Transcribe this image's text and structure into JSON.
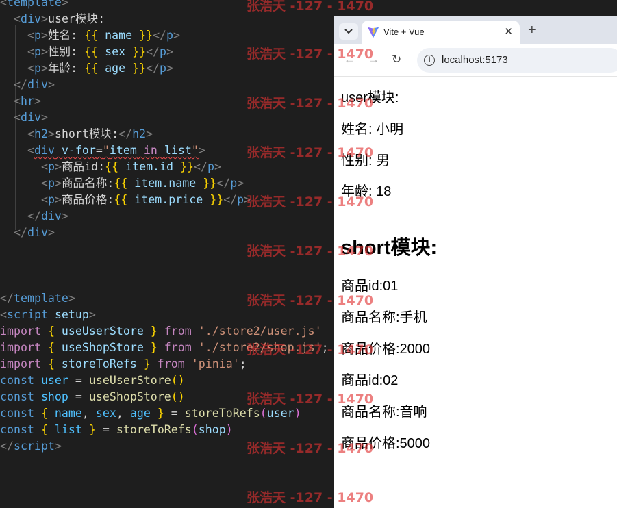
{
  "editor": {
    "lines": [
      [
        [
          "t-br",
          "<"
        ],
        [
          "t-tag",
          "template"
        ],
        [
          "t-br",
          ">"
        ]
      ],
      [
        [
          "t-txt",
          "  "
        ],
        [
          "t-br",
          "<"
        ],
        [
          "t-tag",
          "div"
        ],
        [
          "t-br",
          ">"
        ],
        [
          "t-txt",
          "user模块:"
        ]
      ],
      [
        [
          "t-txt",
          "    "
        ],
        [
          "t-br",
          "<"
        ],
        [
          "t-tag",
          "p"
        ],
        [
          "t-br",
          ">"
        ],
        [
          "t-txt",
          "姓名: "
        ],
        [
          "t-mus",
          "{{"
        ],
        [
          "t-var",
          " name "
        ],
        [
          "t-mus",
          "}}"
        ],
        [
          "t-br",
          "</"
        ],
        [
          "t-tag",
          "p"
        ],
        [
          "t-br",
          ">"
        ]
      ],
      [
        [
          "t-txt",
          "    "
        ],
        [
          "t-br",
          "<"
        ],
        [
          "t-tag",
          "p"
        ],
        [
          "t-br",
          ">"
        ],
        [
          "t-txt",
          "性别: "
        ],
        [
          "t-mus",
          "{{"
        ],
        [
          "t-var",
          " sex "
        ],
        [
          "t-mus",
          "}}"
        ],
        [
          "t-br",
          "</"
        ],
        [
          "t-tag",
          "p"
        ],
        [
          "t-br",
          ">"
        ]
      ],
      [
        [
          "t-txt",
          "    "
        ],
        [
          "t-br",
          "<"
        ],
        [
          "t-tag",
          "p"
        ],
        [
          "t-br",
          ">"
        ],
        [
          "t-txt",
          "年龄: "
        ],
        [
          "t-mus",
          "{{"
        ],
        [
          "t-var",
          " age "
        ],
        [
          "t-mus",
          "}}"
        ],
        [
          "t-br",
          "</"
        ],
        [
          "t-tag",
          "p"
        ],
        [
          "t-br",
          ">"
        ]
      ],
      [
        [
          "t-txt",
          "  "
        ],
        [
          "t-br",
          "</"
        ],
        [
          "t-tag",
          "div"
        ],
        [
          "t-br",
          ">"
        ]
      ],
      [
        [
          "t-txt",
          "  "
        ],
        [
          "t-br",
          "<"
        ],
        [
          "t-tag",
          "hr"
        ],
        [
          "t-br",
          ">"
        ]
      ],
      [
        [
          "t-txt",
          "  "
        ],
        [
          "t-br",
          "<"
        ],
        [
          "t-tag",
          "div"
        ],
        [
          "t-br",
          ">"
        ]
      ],
      [
        [
          "t-txt",
          "    "
        ],
        [
          "t-br",
          "<"
        ],
        [
          "t-tag",
          "h2"
        ],
        [
          "t-br",
          ">"
        ],
        [
          "t-txt",
          "short模块:"
        ],
        [
          "t-br",
          "</"
        ],
        [
          "t-tag",
          "h2"
        ],
        [
          "t-br",
          ">"
        ]
      ],
      [
        [
          "t-txt",
          "    "
        ],
        [
          "t-br",
          "<"
        ],
        [
          "t-tag squiggle",
          "div"
        ],
        [
          "t-attr squiggle",
          " v-for"
        ],
        [
          "t-op squiggle",
          "="
        ],
        [
          "t-str squiggle",
          "\""
        ],
        [
          "t-var squiggle",
          "item"
        ],
        [
          "t-kw squiggle",
          " in "
        ],
        [
          "t-var squiggle",
          "list"
        ],
        [
          "t-str squiggle",
          "\""
        ],
        [
          "t-br",
          ">"
        ]
      ],
      [
        [
          "t-txt",
          "      "
        ],
        [
          "t-br",
          "<"
        ],
        [
          "t-tag",
          "p"
        ],
        [
          "t-br",
          ">"
        ],
        [
          "t-txt",
          "商品id:"
        ],
        [
          "t-mus",
          "{{"
        ],
        [
          "t-var",
          " item.id "
        ],
        [
          "t-mus",
          "}}"
        ],
        [
          "t-br",
          "</"
        ],
        [
          "t-tag",
          "p"
        ],
        [
          "t-br",
          ">"
        ]
      ],
      [
        [
          "t-txt",
          "      "
        ],
        [
          "t-br",
          "<"
        ],
        [
          "t-tag",
          "p"
        ],
        [
          "t-br",
          ">"
        ],
        [
          "t-txt",
          "商品名称:"
        ],
        [
          "t-mus",
          "{{"
        ],
        [
          "t-var",
          " item.name "
        ],
        [
          "t-mus",
          "}}"
        ],
        [
          "t-br",
          "</"
        ],
        [
          "t-tag",
          "p"
        ],
        [
          "t-br",
          ">"
        ]
      ],
      [
        [
          "t-txt",
          "      "
        ],
        [
          "t-br",
          "<"
        ],
        [
          "t-tag",
          "p"
        ],
        [
          "t-br",
          ">"
        ],
        [
          "t-txt",
          "商品价格:"
        ],
        [
          "t-mus",
          "{{"
        ],
        [
          "t-var",
          " item.price "
        ],
        [
          "t-mus",
          "}}"
        ],
        [
          "t-br",
          "</"
        ],
        [
          "t-tag",
          "p"
        ],
        [
          "t-br",
          ">"
        ]
      ],
      [
        [
          "t-txt",
          "    "
        ],
        [
          "t-br",
          "</"
        ],
        [
          "t-tag",
          "div"
        ],
        [
          "t-br",
          ">"
        ]
      ],
      [
        [
          "t-txt",
          "  "
        ],
        [
          "t-br",
          "</"
        ],
        [
          "t-tag",
          "div"
        ],
        [
          "t-br",
          ">"
        ]
      ],
      [],
      [],
      [],
      [
        [
          "t-br",
          "</"
        ],
        [
          "t-tag",
          "template"
        ],
        [
          "t-br",
          ">"
        ]
      ],
      [
        [
          "t-br",
          "<"
        ],
        [
          "t-tag",
          "script"
        ],
        [
          "t-attr",
          " setup"
        ],
        [
          "t-br",
          ">"
        ]
      ],
      [
        [
          "t-kw",
          "import"
        ],
        [
          "t-brace2",
          " {"
        ],
        [
          "t-var",
          " useUserStore "
        ],
        [
          "t-brace2",
          "}"
        ],
        [
          "t-kw",
          " from "
        ],
        [
          "t-str",
          "'./store2/user.js'"
        ]
      ],
      [
        [
          "t-kw",
          "import"
        ],
        [
          "t-brace2",
          " {"
        ],
        [
          "t-var",
          " useShopStore "
        ],
        [
          "t-brace2",
          "}"
        ],
        [
          "t-kw",
          " from "
        ],
        [
          "t-str",
          "'./store2/shop.js'"
        ],
        [
          "t-op",
          ";"
        ]
      ],
      [
        [
          "t-kw",
          "import"
        ],
        [
          "t-brace2",
          " {"
        ],
        [
          "t-var",
          " storeToRefs "
        ],
        [
          "t-brace2",
          "}"
        ],
        [
          "t-kw",
          " from "
        ],
        [
          "t-str",
          "'pinia'"
        ],
        [
          "t-op",
          ";"
        ]
      ],
      [
        [
          "t-const",
          "const"
        ],
        [
          "t-cvar",
          " user"
        ],
        [
          "t-op",
          " = "
        ],
        [
          "t-fn",
          "useUserStore"
        ],
        [
          "t-brace2",
          "()"
        ]
      ],
      [
        [
          "t-const",
          "const"
        ],
        [
          "t-cvar",
          " shop"
        ],
        [
          "t-op",
          " = "
        ],
        [
          "t-fn",
          "useShopStore"
        ],
        [
          "t-brace2",
          "()"
        ]
      ],
      [
        [
          "t-const",
          "const"
        ],
        [
          "t-brace2",
          " {"
        ],
        [
          "t-cvar",
          " name"
        ],
        [
          "t-op",
          ","
        ],
        [
          "t-cvar",
          " sex"
        ],
        [
          "t-op",
          ","
        ],
        [
          "t-cvar",
          " age "
        ],
        [
          "t-brace2",
          "}"
        ],
        [
          "t-op",
          " = "
        ],
        [
          "t-fn",
          "storeToRefs"
        ],
        [
          "t-paren",
          "("
        ],
        [
          "t-var",
          "user"
        ],
        [
          "t-paren",
          ")"
        ]
      ],
      [
        [
          "t-const",
          "const"
        ],
        [
          "t-brace2",
          " {"
        ],
        [
          "t-cvar",
          " list "
        ],
        [
          "t-brace2",
          "}"
        ],
        [
          "t-op",
          " = "
        ],
        [
          "t-fn",
          "storeToRefs"
        ],
        [
          "t-paren",
          "("
        ],
        [
          "t-var",
          "shop"
        ],
        [
          "t-paren",
          ")"
        ]
      ],
      [
        [
          "t-br",
          "</"
        ],
        [
          "t-tag",
          "script"
        ],
        [
          "t-br",
          ">"
        ]
      ]
    ]
  },
  "browser": {
    "tab_title": "Vite + Vue",
    "tab_close_glyph": "✕",
    "new_tab_glyph": "+",
    "back_glyph": "←",
    "forward_glyph": "→",
    "reload_glyph": "↻",
    "info_glyph": "i",
    "url": "localhost:5173",
    "page": {
      "user_heading": "user模块:",
      "name_line": "姓名: 小明",
      "sex_line": "性别: 男",
      "age_line": "年龄: 18",
      "short_heading": "short模块:",
      "items": [
        {
          "id_line": "商品id:01",
          "name_line": "商品名称:手机",
          "price_line": "商品价格:2000"
        },
        {
          "id_line": "商品id:02",
          "name_line": "商品名称:音响",
          "price_line": "商品价格:5000"
        }
      ]
    }
  },
  "watermark": "张浩天 -127 - 1470",
  "colors": {
    "editor_bg": "#1e1e1e",
    "tag": "#569cd6",
    "string": "#ce9178",
    "keyword": "#c586c0",
    "function": "#dcdcaa",
    "mustache": "#ffd700",
    "watermark": "#e13232"
  }
}
